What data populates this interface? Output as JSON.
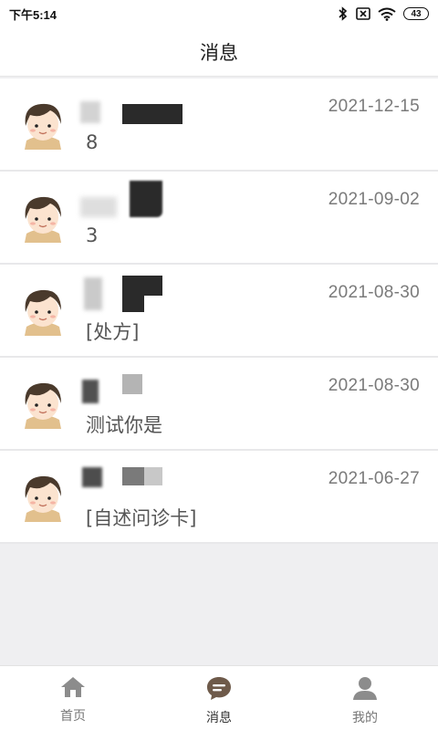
{
  "status_bar": {
    "time": "下午5:14",
    "battery": "43",
    "icons": [
      "bluetooth-icon",
      "sim-off-icon",
      "wifi-icon",
      "battery-icon"
    ]
  },
  "header": {
    "title": "消息"
  },
  "messages": [
    {
      "date": "2021-12-15",
      "preview": "8"
    },
    {
      "date": "2021-09-02",
      "preview": "3"
    },
    {
      "date": "2021-08-30",
      "preview": "[处方]"
    },
    {
      "date": "2021-08-30",
      "preview": "测试你是"
    },
    {
      "date": "2021-06-27",
      "preview": "[自述问诊卡]"
    }
  ],
  "tabs": [
    {
      "label": "首页",
      "icon": "home-icon",
      "active": false
    },
    {
      "label": "消息",
      "icon": "message-icon",
      "active": true
    },
    {
      "label": "我的",
      "icon": "person-icon",
      "active": false
    }
  ],
  "colors": {
    "background": "#efeff1",
    "active_tab": "#6e5a4a",
    "inactive_tab": "#8c8c8c",
    "date_text": "#7a7a7a"
  }
}
